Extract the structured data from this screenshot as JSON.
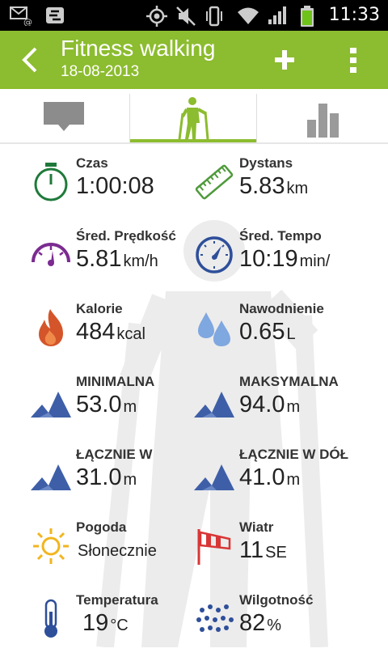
{
  "status_bar": {
    "time": "11:33"
  },
  "header": {
    "title": "Fitness walking",
    "date": "18-08-2013"
  },
  "tabs": [
    {
      "icon": "comment-icon",
      "selected": false
    },
    {
      "icon": "hiker-icon",
      "selected": true
    },
    {
      "icon": "bar-chart-icon",
      "selected": false
    }
  ],
  "colors": {
    "accent": "#8cbc2f",
    "mountain": "#3e5fa8",
    "timer": "#1f7a3a",
    "ruler": "#4f9a3b",
    "speed": "#7b2b91",
    "pace": "#2e4f9a",
    "flame": "#d4552a",
    "sun": "#f2b51e",
    "wind": "#d83636"
  },
  "stats": {
    "czas": {
      "label": "Czas",
      "value": "1:00:08",
      "unit": ""
    },
    "dystans": {
      "label": "Dystans",
      "value": "5.83",
      "unit": "km"
    },
    "predkosc": {
      "label": "Śred. Prędkość",
      "value": "5.81",
      "unit": "km/h"
    },
    "tempo": {
      "label": "Śred. Tempo",
      "value": "10:19",
      "unit": "min/"
    },
    "kalorie": {
      "label": "Kalorie",
      "value": "484",
      "unit": "kcal"
    },
    "nawodnienie": {
      "label": "Nawodnienie",
      "value": "0.65",
      "unit": "L"
    },
    "minimalna": {
      "label": "MINIMALNA",
      "value": "53.0",
      "unit": "m"
    },
    "maksymalna": {
      "label": "MAKSYMALNA",
      "value": "94.0",
      "unit": "m"
    },
    "lacznie_w": {
      "label": "ŁĄCZNIE W",
      "value": "31.0",
      "unit": "m"
    },
    "lacznie_w_dol": {
      "label": "ŁĄCZNIE W DÓŁ",
      "value": "41.0",
      "unit": "m"
    },
    "pogoda": {
      "label": "Pogoda",
      "value": "Słonecznie"
    },
    "wiatr": {
      "label": "Wiatr",
      "value": "11",
      "unit": "SE"
    },
    "temperatura": {
      "label": "Temperatura",
      "value": "19",
      "unit": "°C"
    },
    "wilgotnosc": {
      "label": "Wilgotność",
      "value": "82",
      "unit": "%"
    }
  }
}
